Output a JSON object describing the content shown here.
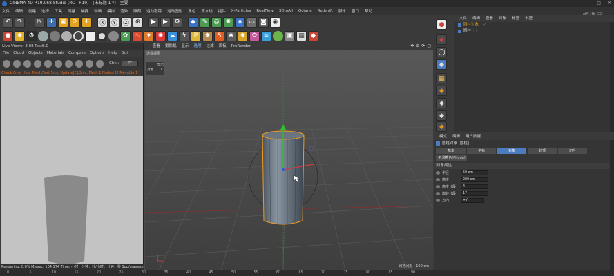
{
  "title": "CINEMA 4D R19.068 Studio (RC - R19) - [未标题 1 *] - 主要",
  "menu": [
    "文件",
    "编辑",
    "创建",
    "选择",
    "工具",
    "网格",
    "捕捉",
    "动画",
    "模拟",
    "渲染",
    "雕刻",
    "运动跟踪",
    "运动图形",
    "角色",
    "流水线",
    "插件",
    "X-Particles",
    "RealFlow",
    "3DtoAll",
    "Octane",
    "Redshift",
    "脚本",
    "窗口",
    "帮助"
  ],
  "live_viewer": {
    "title": "Live Viewer 3.08-TestB.0",
    "menu": [
      "File",
      "Cloud",
      "Objects",
      "Materials",
      "Compare",
      "Options",
      "Help",
      "Gui"
    ],
    "channel_label": "Chnl:",
    "channel_value": "PT",
    "status": "Check:6ms, Hide_Mesh/Sort:5ms, Update[C]:3ms, Mesh:1 Nodes:32 Movable:1 :0:1",
    "footer": "Rendering: 0.6%   Ms/sec: 104.174   Time: 小时：分钟：秒/小时：分钟：秒   Spp/maxspp: 1/16"
  },
  "viewport": {
    "menu": [
      "查看",
      "摄像机",
      "显示",
      "选项",
      "过滤",
      "面板",
      "ProRender"
    ],
    "active_menu": "选项",
    "label_top": "透视视图",
    "hud_label": "显示",
    "hud_row": [
      "对象",
      "1"
    ],
    "grid_scale": "网格间距 : 100 cm"
  },
  "object_manager": {
    "tabs": [
      "文件",
      "编辑",
      "查看",
      "对象",
      "标签",
      "书签"
    ],
    "items": [
      {
        "name": "圆柱对象"
      },
      {
        "name": "圆柱"
      }
    ]
  },
  "attributes": {
    "tabs": [
      "模式",
      "编辑",
      "用户数据"
    ],
    "object_title": "圆柱对象 [圆柱]",
    "subtabs": [
      "基本",
      "坐标",
      "对象",
      "封顶",
      "切片"
    ],
    "selected_subtab": "对象",
    "phong": "平滑着色(Phong)",
    "section": "对象属性",
    "params": [
      {
        "label": "半径",
        "value": "50 cm"
      },
      {
        "label": "高度",
        "value": "200 cm"
      },
      {
        "label": "高度分段",
        "value": "4"
      },
      {
        "label": "旋转分段",
        "value": "17"
      },
      {
        "label": "方向",
        "value": "+Y"
      }
    ]
  },
  "timeline": [
    "0",
    "5",
    "10",
    "15",
    "20",
    "25",
    "30",
    "35",
    "40",
    "45",
    "50",
    "55",
    "60",
    "65",
    "70",
    "75",
    "80",
    "85",
    "90"
  ],
  "watermark": "虎课网",
  "colors": {
    "accent": "#4d7bbf",
    "selection": "#f39a1f",
    "status": "#e56c26"
  }
}
